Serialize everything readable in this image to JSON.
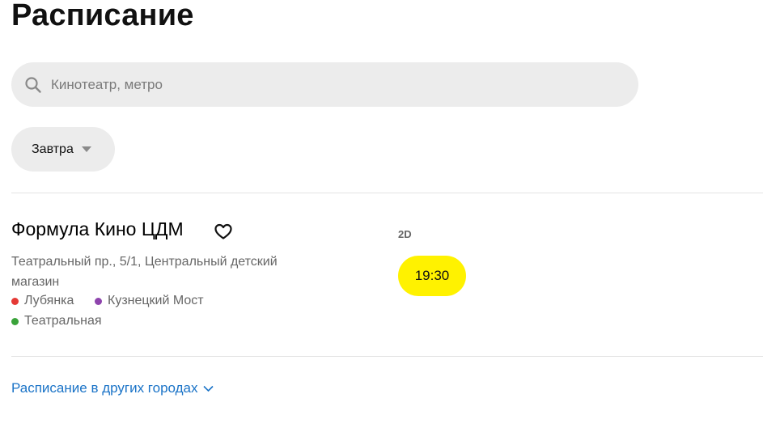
{
  "page": {
    "title": "Расписание"
  },
  "search": {
    "placeholder": "Кинотеатр, метро",
    "icon": "search-icon"
  },
  "date_filter": {
    "selected": "Завтра",
    "icon": "caret-down-icon"
  },
  "cinema": {
    "name": "Формула Кино ЦДМ",
    "favorite_icon": "heart-icon",
    "address": "Театральный пр., 5/1, Центральный детский магазин",
    "metro": [
      {
        "name": "Лубянка",
        "color": "#e53935"
      },
      {
        "name": "Кузнецкий Мост",
        "color": "#8e44ad"
      },
      {
        "name": "Театральная",
        "color": "#3aa33a"
      }
    ],
    "format": "2D",
    "sessions": [
      {
        "time": "19:30"
      }
    ]
  },
  "footer": {
    "other_cities_label": "Расписание в других городах",
    "icon": "chevron-down-icon"
  },
  "colors": {
    "session_bg": "#fff200",
    "link": "#1a73c7",
    "search_bg": "#ececec"
  }
}
